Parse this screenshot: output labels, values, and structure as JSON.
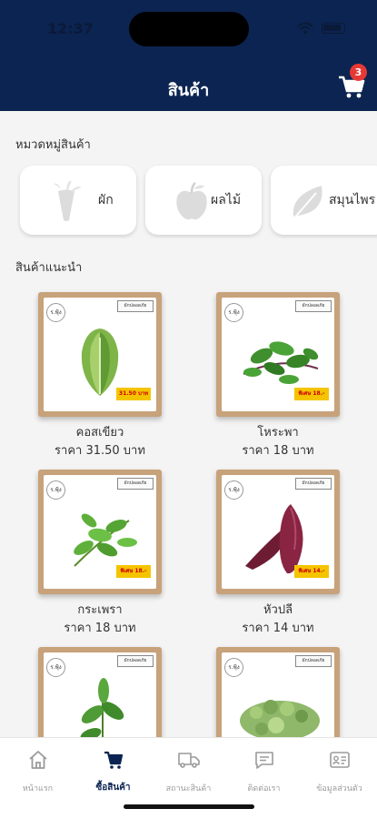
{
  "status_bar": {
    "time": "12:37"
  },
  "header": {
    "title": "สินค้า",
    "cart_count": "3"
  },
  "categories": {
    "title": "หมวดหมู่สินค้า",
    "items": [
      {
        "label": "ผัก",
        "icon": "carrot-icon"
      },
      {
        "label": "ผลไม้",
        "icon": "apple-icon"
      },
      {
        "label": "สมุนไพร",
        "icon": "leaf-icon"
      }
    ]
  },
  "recommended": {
    "title": "สินค้าแนะนำ",
    "products": [
      {
        "name": "คอสเขียว",
        "price": "ราคา 31.50 บาท",
        "tag_price": "31.50 บาท",
        "image": "cos-lettuce"
      },
      {
        "name": "โหระพา",
        "price": "ราคา 18 บาท",
        "tag_price": "พิเศษ 18.-",
        "image": "thai-basil"
      },
      {
        "name": "กระเพรา",
        "price": "ราคา 18 บาท",
        "tag_price": "พิเศษ 18.-",
        "image": "holy-basil"
      },
      {
        "name": "หัวปลี",
        "price": "ราคา 14 บาท",
        "tag_price": "พิเศษ 14.-",
        "image": "banana-blossom"
      },
      {
        "name": "",
        "price": "",
        "tag_price": "",
        "image": "mint"
      },
      {
        "name": "",
        "price": "",
        "tag_price": "",
        "image": "sprouts"
      }
    ]
  },
  "bottom_nav": [
    {
      "label": "หน้าแรก",
      "icon": "home-icon",
      "active": false
    },
    {
      "label": "ซื้อสินค้า",
      "icon": "cart-icon",
      "active": true
    },
    {
      "label": "สถานะสินค้า",
      "icon": "truck-icon",
      "active": false
    },
    {
      "label": "ติดต่อเรา",
      "icon": "message-icon",
      "active": false
    },
    {
      "label": "ข้อมูลส่วนตัว",
      "icon": "profile-card-icon",
      "active": false
    }
  ],
  "colors": {
    "header": "#0c2451",
    "badge": "#e53935",
    "price_tag": "#f5c400",
    "card_frame": "#c7a27a"
  }
}
